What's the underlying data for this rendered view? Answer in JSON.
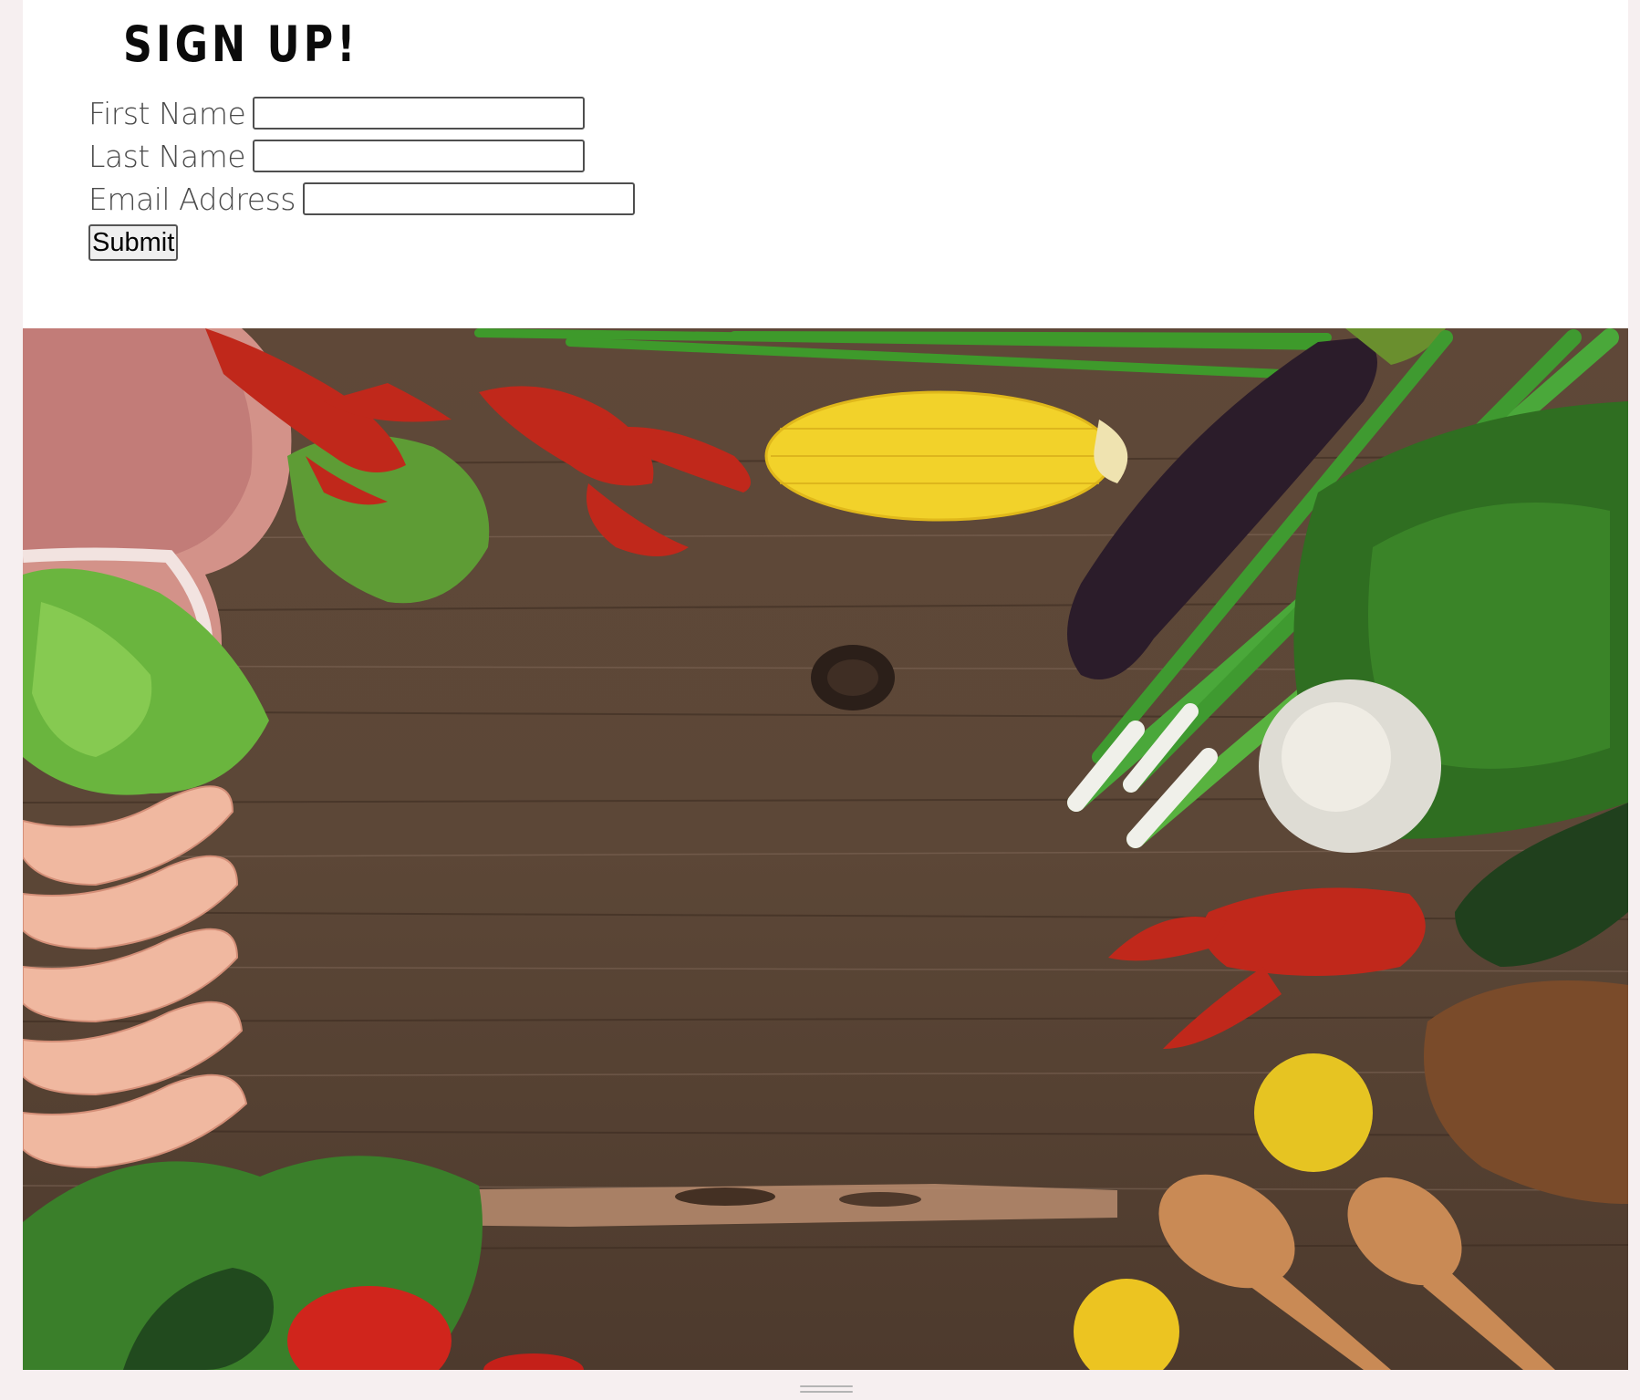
{
  "form": {
    "title": "SIGN UP!",
    "fields": [
      {
        "label": "First Name",
        "value": "",
        "placeholder": ""
      },
      {
        "label": "Last Name",
        "value": "",
        "placeholder": ""
      },
      {
        "label": "Email Address",
        "value": "",
        "placeholder": ""
      }
    ],
    "submit_label": "Submit"
  },
  "hero": {
    "description_icon": "food-ingredients-on-wood-table-image",
    "wood_color": "#5a4536",
    "accent_colors": {
      "crayfish": "#c0281b",
      "corn": "#f2d22a",
      "greens": "#3e9a2b",
      "eggplant": "#2b1c2a",
      "meat": "#cf8e86"
    }
  },
  "colors": {
    "background": "#f6eff0",
    "panel": "#ffffff",
    "title": "#0b0b0b",
    "label": "#4a4a4a"
  }
}
